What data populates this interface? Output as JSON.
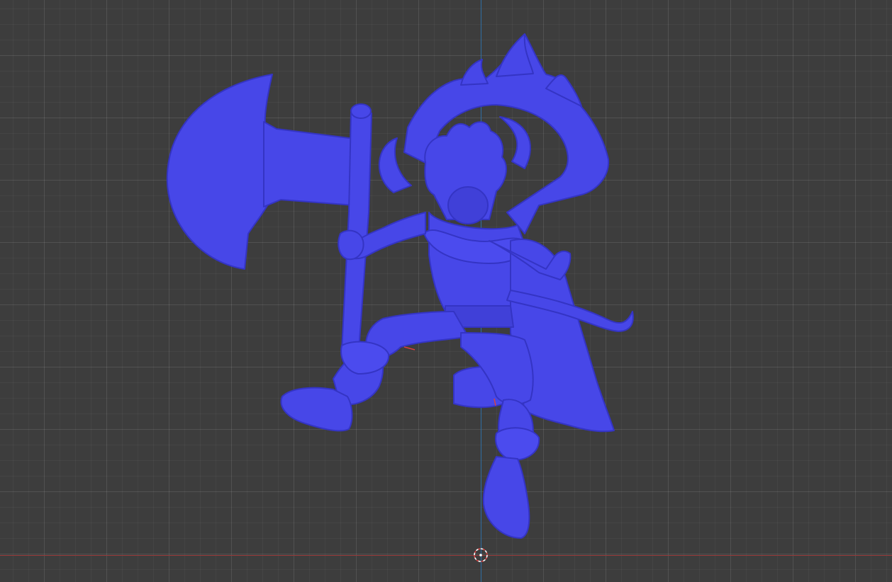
{
  "viewport": {
    "background": "#3d3d3d",
    "grid_color": "#4a4a4a",
    "x_axis_color": "#9a3b3b",
    "y_axis_color": "#2f6ea3"
  },
  "model": {
    "name": "figure-mesh",
    "color": "#4747e8",
    "shade": "#3434c4",
    "highlight": "#6262ff"
  },
  "cursor": {
    "icon": "3d-cursor-icon"
  }
}
